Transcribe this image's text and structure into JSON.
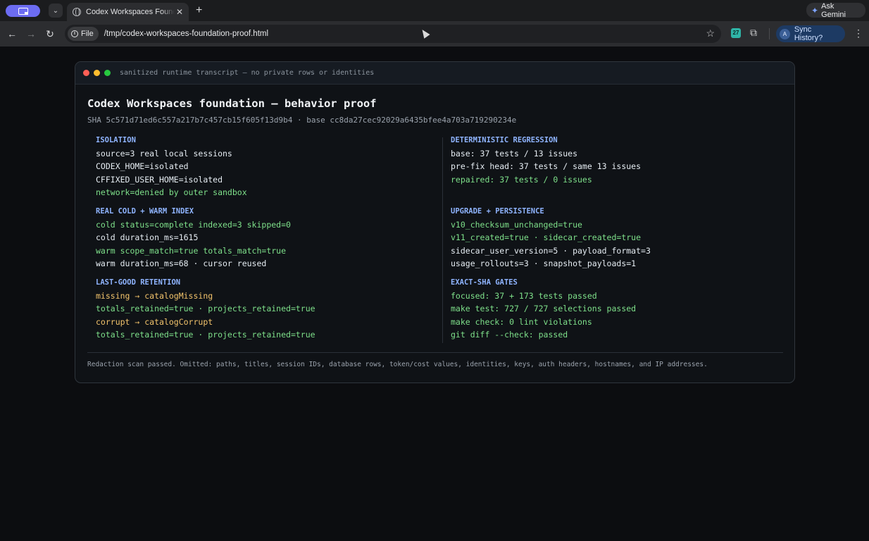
{
  "browser": {
    "tab_title": "Codex Workspaces Foundation",
    "chip_label": "File",
    "url": "/tmp/codex-workspaces-foundation-proof.html",
    "gemini_label": "Ask Gemini",
    "sync_label": "Sync History?",
    "avatar_letter": "A",
    "extension_badge": "27"
  },
  "window": {
    "caption": "sanitized runtime transcript — no private rows or identities"
  },
  "page": {
    "title": "Codex Workspaces foundation — behavior proof",
    "sha_line": "SHA 5c571d71ed6c557a217b7c457cb15f605f13d9b4 · base cc8da27cec92029a6435bfee4a703a719290234e"
  },
  "sections": {
    "isolation": {
      "title": "ISOLATION",
      "lines": [
        {
          "text": "source=3 real local sessions",
          "color": "#e6edf3"
        },
        {
          "text": "CODEX_HOME=isolated",
          "color": "#e6edf3"
        },
        {
          "text": "CFFIXED_USER_HOME=isolated",
          "color": "#e6edf3"
        },
        {
          "text": "network=denied by outer sandbox",
          "color": "#7ee08a"
        }
      ]
    },
    "regression": {
      "title": "DETERMINISTIC REGRESSION",
      "lines": [
        {
          "text": "base: 37 tests / 13 issues",
          "color": "#e6edf3"
        },
        {
          "text": "pre-fix head: 37 tests / same 13 issues",
          "color": "#e6edf3"
        },
        {
          "text": "repaired: 37 tests / 0 issues",
          "color": "#7ee08a"
        }
      ]
    },
    "index": {
      "title": "REAL COLD + WARM INDEX",
      "lines": [
        {
          "text": "cold status=complete indexed=3 skipped=0",
          "color": "#7ee08a"
        },
        {
          "text": "cold duration_ms=1615",
          "color": "#e6edf3"
        },
        {
          "text": "warm scope_match=true totals_match=true",
          "color": "#7ee08a"
        },
        {
          "text": "warm duration_ms=68 · cursor reused",
          "color": "#e6edf3"
        }
      ]
    },
    "persistence": {
      "title": "UPGRADE + PERSISTENCE",
      "lines": [
        {
          "text": "v10_checksum_unchanged=true",
          "color": "#7ee08a"
        },
        {
          "text": "v11_created=true · sidecar_created=true",
          "color": "#7ee08a"
        },
        {
          "text": "sidecar_user_version=5 · payload_format=3",
          "color": "#e6edf3"
        },
        {
          "text": "usage_rollouts=3 · snapshot_payloads=1",
          "color": "#e6edf3"
        }
      ]
    },
    "retention": {
      "title": "LAST-GOOD RETENTION",
      "lines": [
        {
          "text": "missing → catalogMissing",
          "color": "#f2c36b"
        },
        {
          "text": "totals_retained=true · projects_retained=true",
          "color": "#7ee08a"
        },
        {
          "text": "corrupt → catalogCorrupt",
          "color": "#f2c36b"
        },
        {
          "text": "totals_retained=true · projects_retained=true",
          "color": "#7ee08a"
        }
      ]
    },
    "gates": {
      "title": "EXACT-SHA GATES",
      "lines": [
        {
          "text": "focused: 37 + 173 tests passed",
          "color": "#7ee08a"
        },
        {
          "text": "make test: 727 / 727 selections passed",
          "color": "#7ee08a"
        },
        {
          "text": "make check: 0 lint violations",
          "color": "#7ee08a"
        },
        {
          "text": "git diff --check: passed",
          "color": "#7ee08a"
        }
      ]
    }
  },
  "footer": "Redaction scan passed. Omitted: paths, titles, session IDs, database rows, token/cost values, identities, keys, auth headers, hostnames, and IP addresses."
}
